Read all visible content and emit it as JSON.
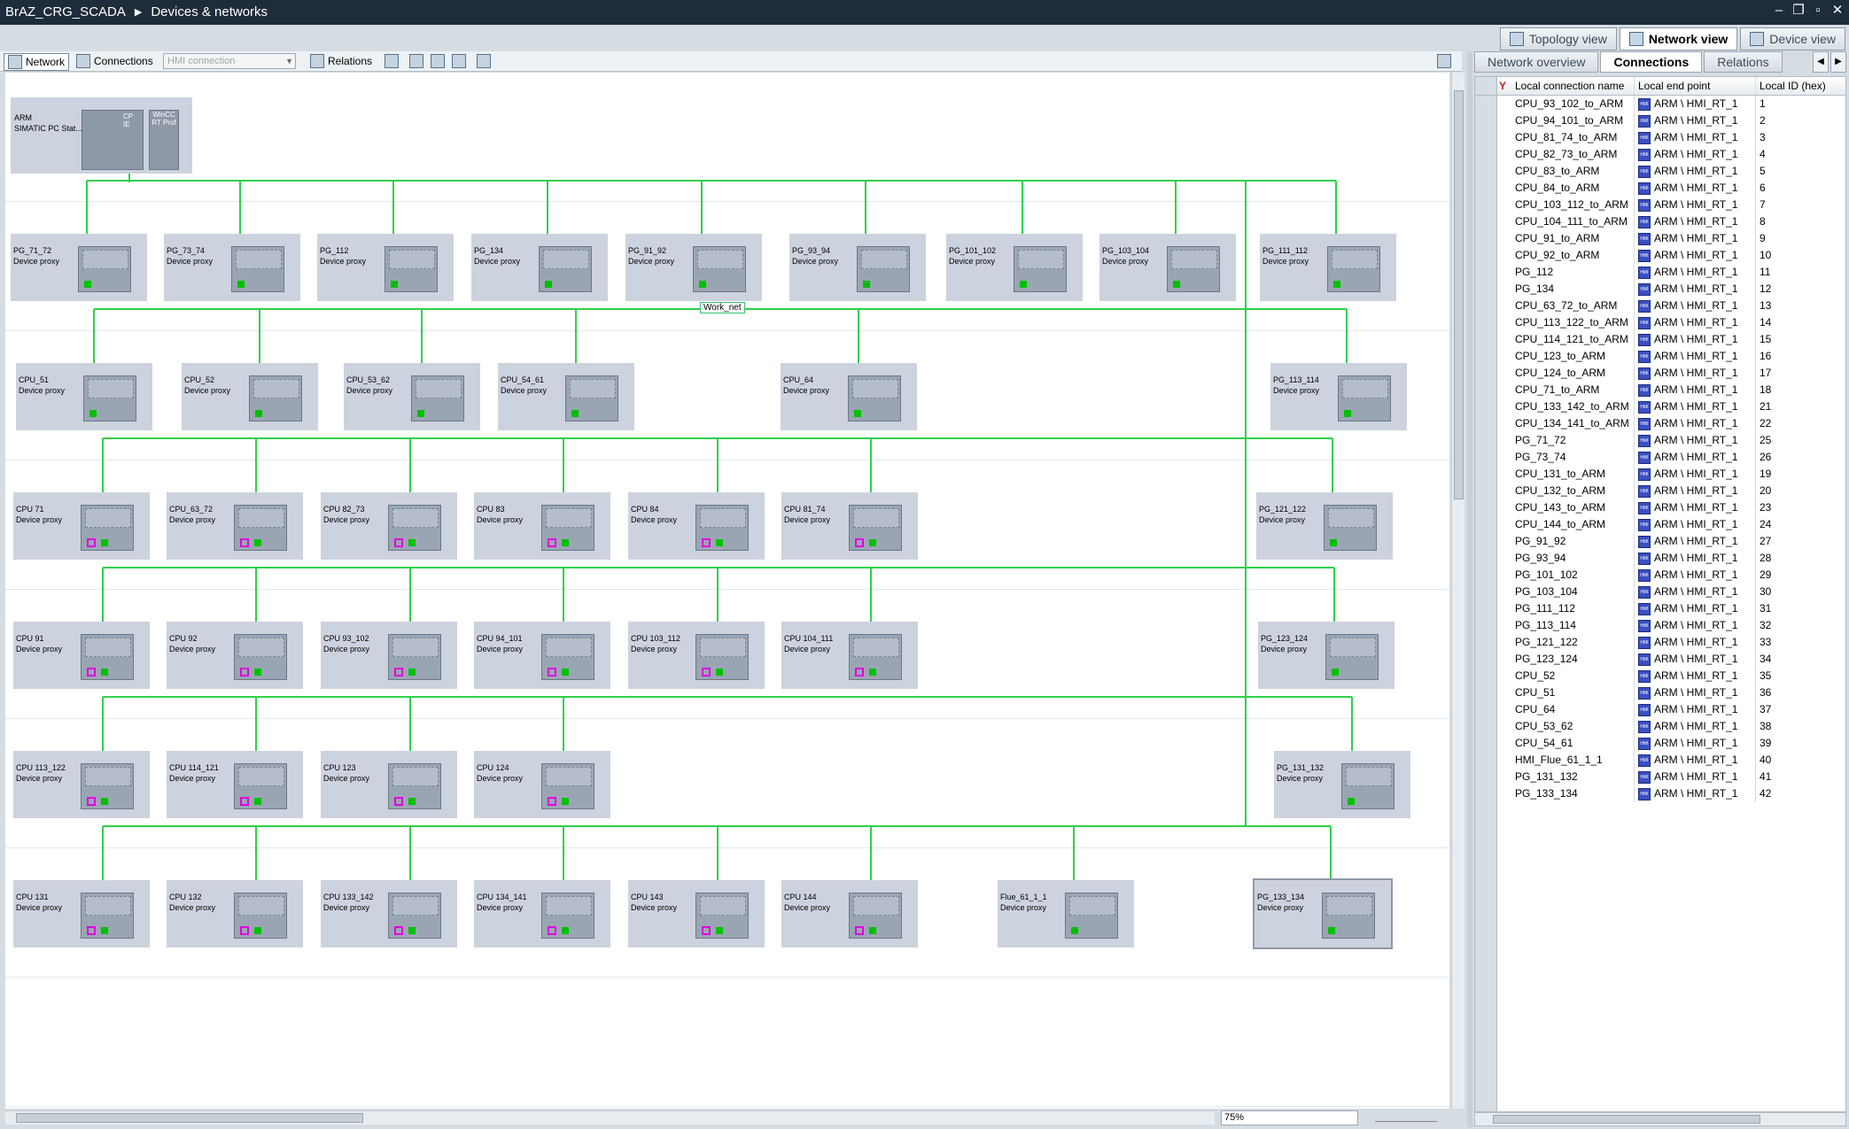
{
  "title": {
    "project": "BrAZ_CRG_SCADA",
    "page": "Devices & networks",
    "window_controls": [
      "–",
      "❐",
      "▫",
      "✕"
    ]
  },
  "view_tabs": [
    "Topology view",
    "Network view",
    "Device view"
  ],
  "toolbar": {
    "network": "Network",
    "connections": "Connections",
    "connection_type": "HMI connection",
    "relations": "Relations"
  },
  "network": {
    "subnet_name": "Work_net",
    "arm": {
      "name": "ARM",
      "type": "SIMATIC PC Stat...",
      "module1": "CP IE",
      "module2": "WinCC RT Prof"
    },
    "rows": [
      [
        "PG_71_72",
        "PG_73_74",
        "PG_112",
        "PG_134",
        "PG_91_92",
        "PG_93_94",
        "PG_101_102",
        "PG_103_104",
        "PG_111_112"
      ],
      [
        "CPU_51",
        "CPU_52",
        "CPU_53_62",
        "CPU_54_61",
        "CPU_64",
        "PG_113_114"
      ],
      [
        "CPU 71",
        "CPU_63_72",
        "CPU 82_73",
        "CPU 83",
        "CPU 84",
        "CPU 81_74",
        "PG_121_122"
      ],
      [
        "CPU 91",
        "CPU 92",
        "CPU 93_102",
        "CPU 94_101",
        "CPU 103_112",
        "CPU 104_111",
        "PG_123_124"
      ],
      [
        "CPU 113_122",
        "CPU 114_121",
        "CPU 123",
        "CPU 124",
        "PG_131_132"
      ],
      [
        "CPU 131",
        "CPU 132",
        "CPU 133_142",
        "CPU 134_141",
        "CPU 143",
        "CPU 144",
        "Flue_61_1_1",
        "PG_133_134"
      ]
    ],
    "device_type": "Device proxy"
  },
  "zoom": "75%",
  "right_panel": {
    "tabs": [
      "Network overview",
      "Connections",
      "Relations"
    ],
    "columns": [
      "Local connection name",
      "Local end point",
      "Local ID (hex)"
    ],
    "rows": [
      [
        "CPU_93_102_to_ARM",
        "ARM \\ HMI_RT_1",
        "1"
      ],
      [
        "CPU_94_101_to_ARM",
        "ARM \\ HMI_RT_1",
        "2"
      ],
      [
        "CPU_81_74_to_ARM",
        "ARM \\ HMI_RT_1",
        "3"
      ],
      [
        "CPU_82_73_to_ARM",
        "ARM \\ HMI_RT_1",
        "4"
      ],
      [
        "CPU_83_to_ARM",
        "ARM \\ HMI_RT_1",
        "5"
      ],
      [
        "CPU_84_to_ARM",
        "ARM \\ HMI_RT_1",
        "6"
      ],
      [
        "CPU_103_112_to_ARM",
        "ARM \\ HMI_RT_1",
        "7"
      ],
      [
        "CPU_104_111_to_ARM",
        "ARM \\ HMI_RT_1",
        "8"
      ],
      [
        "CPU_91_to_ARM",
        "ARM \\ HMI_RT_1",
        "9"
      ],
      [
        "CPU_92_to_ARM",
        "ARM \\ HMI_RT_1",
        "10"
      ],
      [
        "PG_112",
        "ARM \\ HMI_RT_1",
        "11"
      ],
      [
        "PG_134",
        "ARM \\ HMI_RT_1",
        "12"
      ],
      [
        "CPU_63_72_to_ARM",
        "ARM \\ HMI_RT_1",
        "13"
      ],
      [
        "CPU_113_122_to_ARM",
        "ARM \\ HMI_RT_1",
        "14"
      ],
      [
        "CPU_114_121_to_ARM",
        "ARM \\ HMI_RT_1",
        "15"
      ],
      [
        "CPU_123_to_ARM",
        "ARM \\ HMI_RT_1",
        "16"
      ],
      [
        "CPU_124_to_ARM",
        "ARM \\ HMI_RT_1",
        "17"
      ],
      [
        "CPU_71_to_ARM",
        "ARM \\ HMI_RT_1",
        "18"
      ],
      [
        "CPU_133_142_to_ARM",
        "ARM \\ HMI_RT_1",
        "21"
      ],
      [
        "CPU_134_141_to_ARM",
        "ARM \\ HMI_RT_1",
        "22"
      ],
      [
        "PG_71_72",
        "ARM \\ HMI_RT_1",
        "25"
      ],
      [
        "PG_73_74",
        "ARM \\ HMI_RT_1",
        "26"
      ],
      [
        "CPU_131_to_ARM",
        "ARM \\ HMI_RT_1",
        "19"
      ],
      [
        "CPU_132_to_ARM",
        "ARM \\ HMI_RT_1",
        "20"
      ],
      [
        "CPU_143_to_ARM",
        "ARM \\ HMI_RT_1",
        "23"
      ],
      [
        "CPU_144_to_ARM",
        "ARM \\ HMI_RT_1",
        "24"
      ],
      [
        "PG_91_92",
        "ARM \\ HMI_RT_1",
        "27"
      ],
      [
        "PG_93_94",
        "ARM \\ HMI_RT_1",
        "28"
      ],
      [
        "PG_101_102",
        "ARM \\ HMI_RT_1",
        "29"
      ],
      [
        "PG_103_104",
        "ARM \\ HMI_RT_1",
        "30"
      ],
      [
        "PG_111_112",
        "ARM \\ HMI_RT_1",
        "31"
      ],
      [
        "PG_113_114",
        "ARM \\ HMI_RT_1",
        "32"
      ],
      [
        "PG_121_122",
        "ARM \\ HMI_RT_1",
        "33"
      ],
      [
        "PG_123_124",
        "ARM \\ HMI_RT_1",
        "34"
      ],
      [
        "CPU_52",
        "ARM \\ HMI_RT_1",
        "35"
      ],
      [
        "CPU_51",
        "ARM \\ HMI_RT_1",
        "36"
      ],
      [
        "CPU_64",
        "ARM \\ HMI_RT_1",
        "37"
      ],
      [
        "CPU_53_62",
        "ARM \\ HMI_RT_1",
        "38"
      ],
      [
        "CPU_54_61",
        "ARM \\ HMI_RT_1",
        "39"
      ],
      [
        "HMI_Flue_61_1_1",
        "ARM \\ HMI_RT_1",
        "40"
      ],
      [
        "PG_131_132",
        "ARM \\ HMI_RT_1",
        "41"
      ],
      [
        "PG_133_134",
        "ARM \\ HMI_RT_1",
        "42"
      ]
    ]
  },
  "colors": {
    "net": "#2fd14a",
    "title_bg": "#1f2c3b",
    "device": "#cdd2df",
    "hmi_icon": "#3a4fc2"
  }
}
